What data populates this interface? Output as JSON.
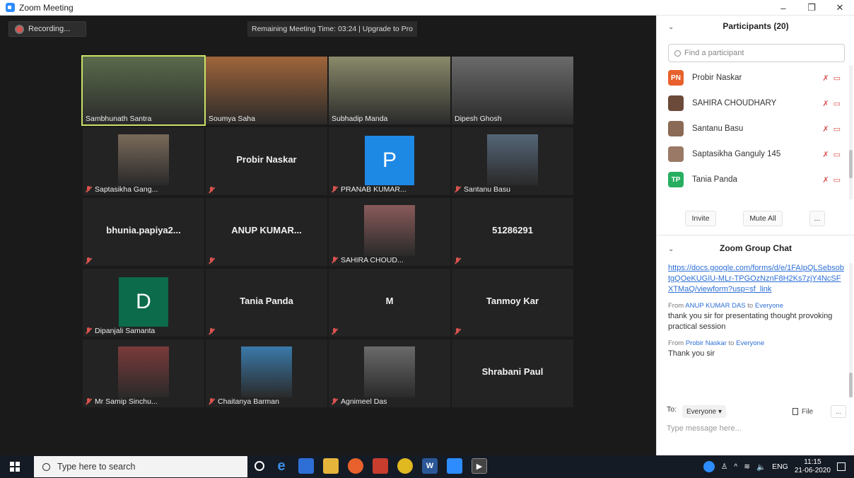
{
  "window": {
    "title": "Zoom Meeting",
    "minimize": "–",
    "maximize": "❐",
    "close": "✕"
  },
  "toolbar": {
    "recording_label": "Recording...",
    "remaining": "Remaining Meeting Time: 03:24 | Upgrade to Pro"
  },
  "tiles": [
    {
      "name": "Sambhunath Santra",
      "center": "",
      "muted": false
    },
    {
      "name": "Soumya Saha",
      "center": "",
      "muted": false
    },
    {
      "name": "Subhadip Manda",
      "center": "",
      "muted": false
    },
    {
      "name": "Dipesh Ghosh",
      "center": "",
      "muted": false
    },
    {
      "name": "Saptasikha Gang...",
      "center": "",
      "muted": true
    },
    {
      "name": "",
      "center": "Probir Naskar",
      "muted": true
    },
    {
      "name": "PRANAB KUMAR...",
      "center": "",
      "initial": "P",
      "muted": true
    },
    {
      "name": "Santanu Basu",
      "center": "",
      "muted": true
    },
    {
      "name": "",
      "center": "bhunia.papiya2...",
      "muted": true
    },
    {
      "name": "",
      "center": "ANUP KUMAR...",
      "muted": true
    },
    {
      "name": "SAHIRA CHOUD...",
      "center": "",
      "muted": true
    },
    {
      "name": "",
      "center": "51286291",
      "muted": true
    },
    {
      "name": "Dipanjali Samanta",
      "center": "",
      "initial": "D",
      "muted": true
    },
    {
      "name": "",
      "center": "Tania Panda",
      "muted": true
    },
    {
      "name": "",
      "center": "M",
      "muted": true
    },
    {
      "name": "",
      "center": "Tanmoy Kar",
      "muted": true
    },
    {
      "name": "Mr Samip Sinchu...",
      "center": "",
      "muted": true
    },
    {
      "name": "Chaitanya Barman",
      "center": "",
      "muted": true
    },
    {
      "name": "Agnimeel Das",
      "center": "",
      "muted": true
    },
    {
      "name": "",
      "center": "Shrabani Paul",
      "muted": false
    }
  ],
  "participants": {
    "title": "Participants (20)",
    "search_placeholder": "Find a participant",
    "list": [
      {
        "name": "Probir Naskar",
        "initials": "PN",
        "color": "#e8612c"
      },
      {
        "name": "SAHIRA CHOUDHARY",
        "initials": "",
        "color": "#6b4a3a"
      },
      {
        "name": "Santanu Basu",
        "initials": "",
        "color": "#8a6a55"
      },
      {
        "name": "Saptasikha Ganguly 145",
        "initials": "",
        "color": "#9a7a66"
      },
      {
        "name": "Tania Panda",
        "initials": "TP",
        "color": "#27ae60"
      }
    ],
    "invite": "Invite",
    "mute_all": "Mute All",
    "more": "..."
  },
  "chat": {
    "title": "Zoom Group Chat",
    "link": "https://docs.google.com/forms/d/e/1FAIpQLSebsobtgQOeKUGIU-MLr-TPGOzNznF8H2Ks7zjY4NcSFXTMaQ/viewform?usp=sf_link",
    "m1_prefix": "From",
    "m1_from": "ANUP KUMAR DAS",
    "m1_to_word": "to",
    "m1_to": "Everyone",
    "m1_text": "thank you sir for presentating thought provoking practical session",
    "m2_prefix": "From",
    "m2_from": "Probir Naskar",
    "m2_to_word": "to",
    "m2_to": "Everyone",
    "m2_text": "Thank you sir",
    "to_label": "To:",
    "to_value": "Everyone ▾",
    "file_label": "File",
    "more": "...",
    "placeholder": "Type message here..."
  },
  "taskbar": {
    "search_placeholder": "Type here to search",
    "lang": "ENG",
    "time": "11:15",
    "date": "21-06-2020"
  }
}
